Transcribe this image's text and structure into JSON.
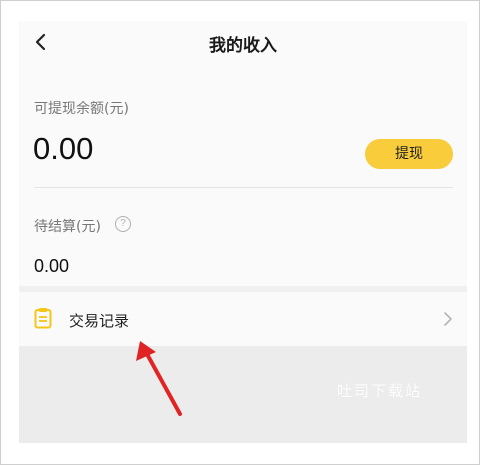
{
  "header": {
    "title": "我的收入",
    "back_icon": "chevron-left-icon"
  },
  "balance": {
    "label": "可提现余额(元)",
    "amount": "0.00",
    "withdraw_label": "提现"
  },
  "pending": {
    "label": "待结算(元)",
    "help_glyph": "?",
    "amount": "0.00"
  },
  "transactions": {
    "label": "交易记录",
    "icon": "clipboard-icon",
    "chevron": "chevron-right-icon"
  },
  "watermark": "吐司下载站",
  "colors": {
    "accent": "#f8cc3a",
    "annotation_arrow": "#e02424",
    "clipboard_icon": "#f5c518"
  }
}
